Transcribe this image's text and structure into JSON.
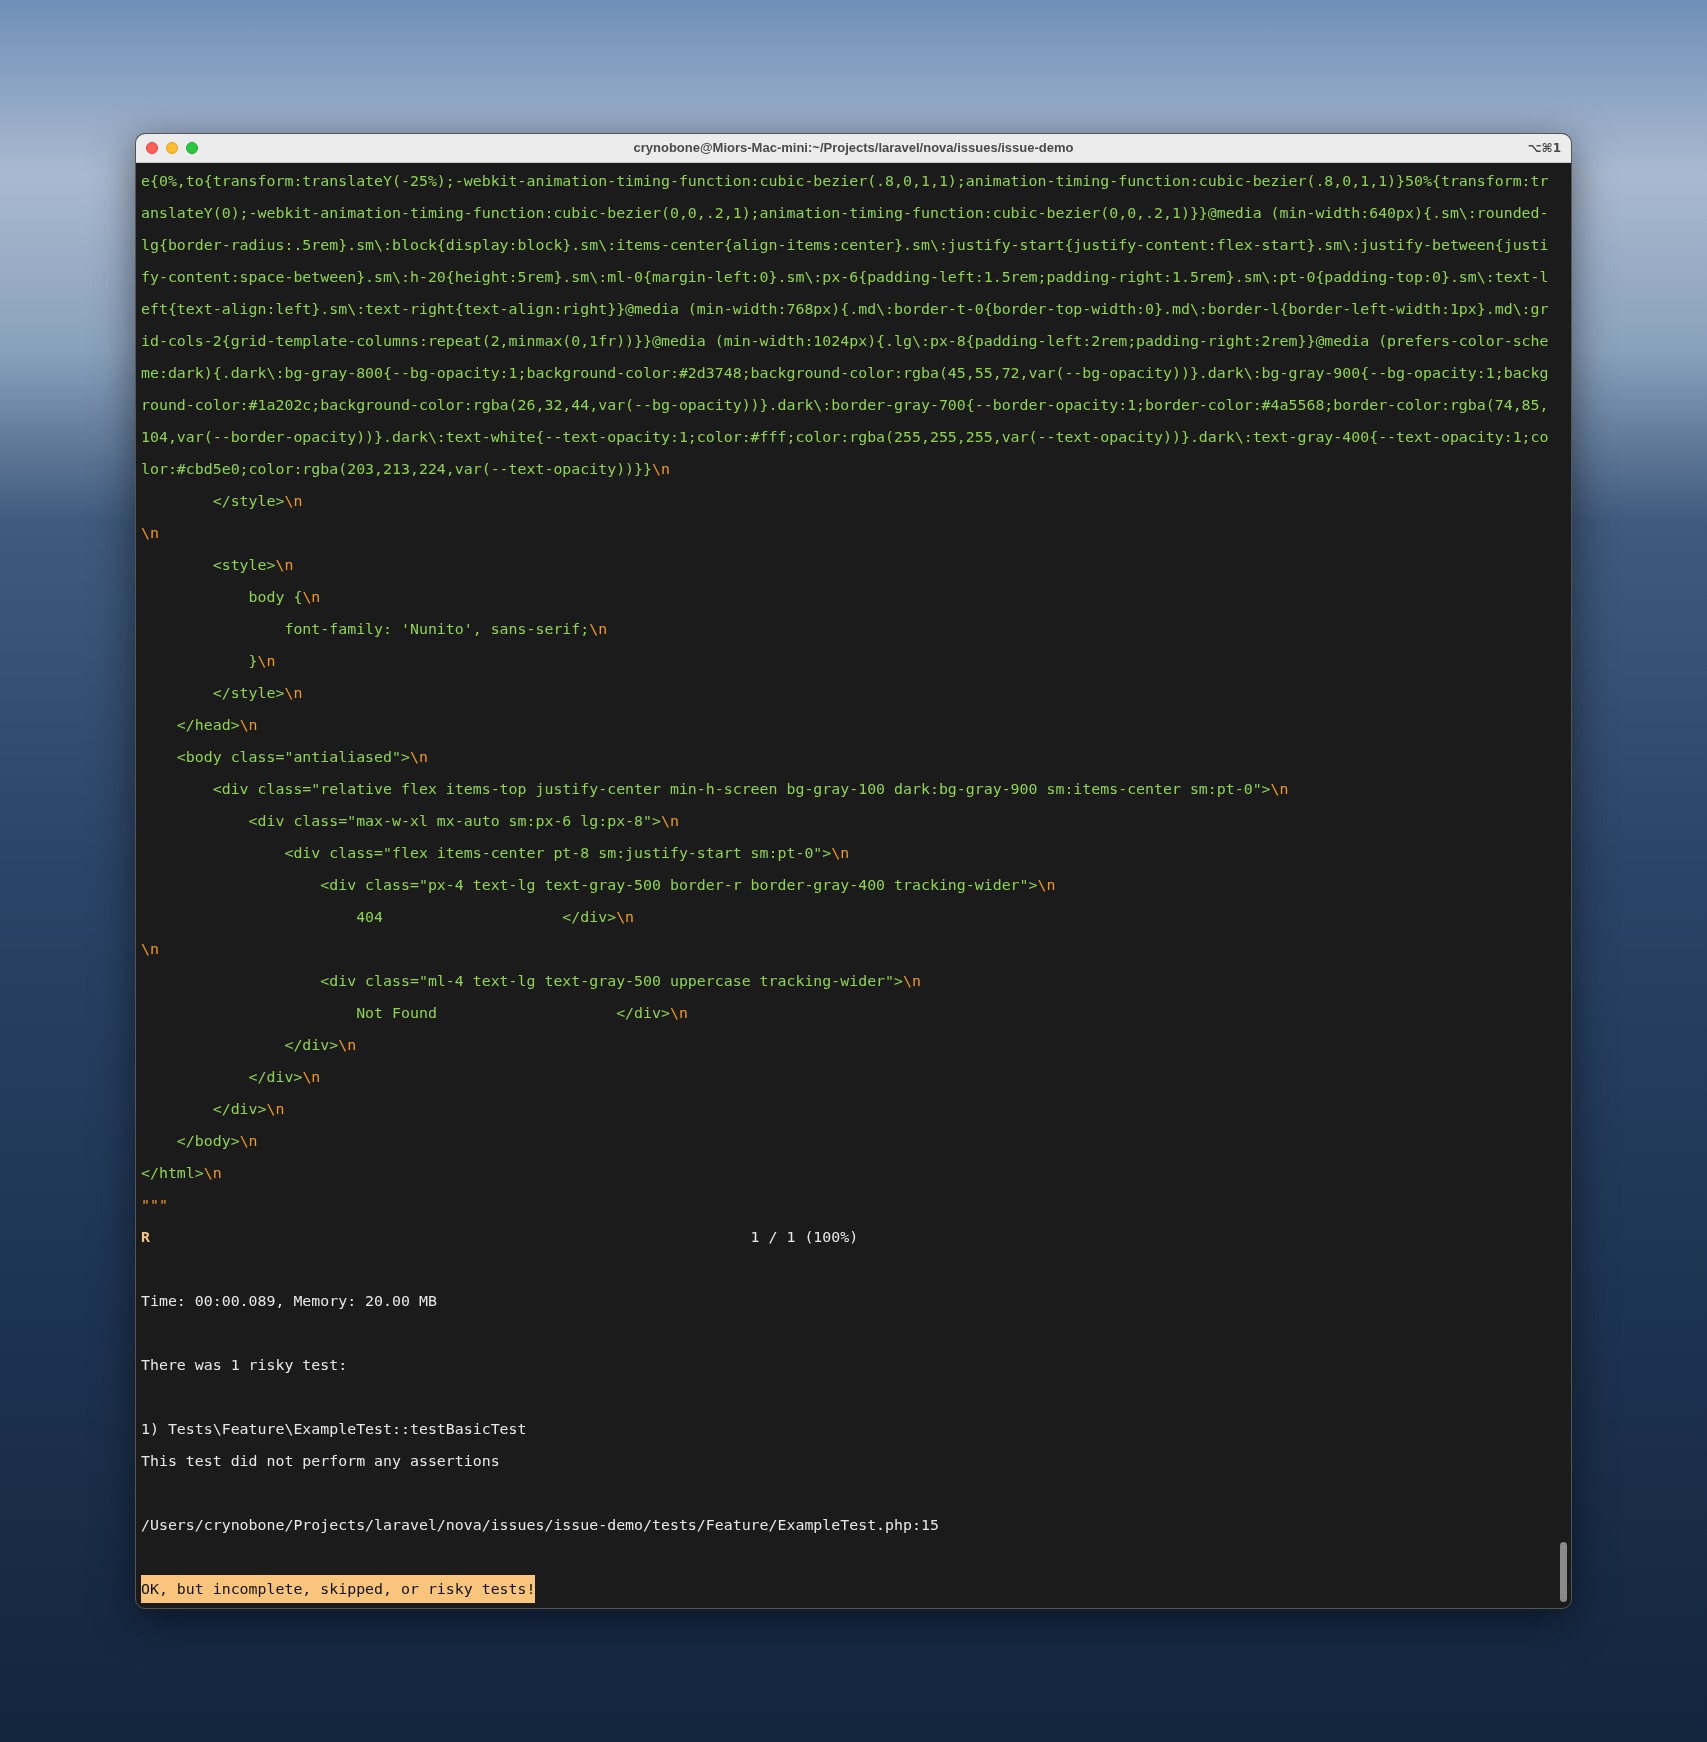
{
  "window": {
    "title": "crynobone@Miors-Mac-mini:~/Projects/laravel/nova/issues/issue-demo",
    "shortcut": "⌥⌘1"
  },
  "terminal": {
    "lines": [
      {
        "kind": "code",
        "text": "e{0%,to{transform:translateY(-25%);-webkit-animation-timing-function:cubic-bezier(.8,0,1,1);animation-timing-function:cubic-bezier(.8,0,1,1)}50%{transform:tr"
      },
      {
        "kind": "code",
        "text": "anslateY(0);-webkit-animation-timing-function:cubic-bezier(0,0,.2,1);animation-timing-function:cubic-bezier(0,0,.2,1)}}@media (min-width:640px){.sm\\:rounded-"
      },
      {
        "kind": "code",
        "text": "lg{border-radius:.5rem}.sm\\:block{display:block}.sm\\:items-center{align-items:center}.sm\\:justify-start{justify-content:flex-start}.sm\\:justify-between{justi"
      },
      {
        "kind": "code",
        "text": "fy-content:space-between}.sm\\:h-20{height:5rem}.sm\\:ml-0{margin-left:0}.sm\\:px-6{padding-left:1.5rem;padding-right:1.5rem}.sm\\:pt-0{padding-top:0}.sm\\:text-l"
      },
      {
        "kind": "code",
        "text": "eft{text-align:left}.sm\\:text-right{text-align:right}}@media (min-width:768px){.md\\:border-t-0{border-top-width:0}.md\\:border-l{border-left-width:1px}.md\\:gr"
      },
      {
        "kind": "code",
        "text": "id-cols-2{grid-template-columns:repeat(2,minmax(0,1fr))}}@media (min-width:1024px){.lg\\:px-8{padding-left:2rem;padding-right:2rem}}@media (prefers-color-sche"
      },
      {
        "kind": "code",
        "text": "me:dark){.dark\\:bg-gray-800{--bg-opacity:1;background-color:#2d3748;background-color:rgba(45,55,72,var(--bg-opacity))}.dark\\:bg-gray-900{--bg-opacity:1;backg"
      },
      {
        "kind": "code",
        "text": "round-color:#1a202c;background-color:rgba(26,32,44,var(--bg-opacity))}.dark\\:border-gray-700{--border-opacity:1;border-color:#4a5568;border-color:rgba(74,85,"
      },
      {
        "kind": "code",
        "text": "104,var(--border-opacity))}.dark\\:text-white{--text-opacity:1;color:#fff;color:rgba(255,255,255,var(--text-opacity))}.dark\\:text-gray-400{--text-opacity:1;co"
      },
      {
        "kind": "code",
        "text": "lor:#cbd5e0;color:rgba(203,213,224,var(--text-opacity))}}",
        "newline": "\\n"
      },
      {
        "kind": "code",
        "text": "        </style>",
        "newline": "\\n"
      },
      {
        "kind": "marker",
        "text": "\\n"
      },
      {
        "kind": "code",
        "text": "        <style>",
        "newline": "\\n"
      },
      {
        "kind": "code",
        "text": "            body {",
        "newline": "\\n"
      },
      {
        "kind": "code",
        "text": "                font-family: 'Nunito', sans-serif;",
        "newline": "\\n"
      },
      {
        "kind": "code",
        "text": "            }",
        "newline": "\\n"
      },
      {
        "kind": "code",
        "text": "        </style>",
        "newline": "\\n"
      },
      {
        "kind": "code",
        "text": "    </head>",
        "newline": "\\n"
      },
      {
        "kind": "code",
        "text": "    <body class=\"antialiased\">",
        "newline": "\\n"
      },
      {
        "kind": "code",
        "text": "        <div class=\"relative flex items-top justify-center min-h-screen bg-gray-100 dark:bg-gray-900 sm:items-center sm:pt-0\">",
        "newline": "\\n"
      },
      {
        "kind": "code",
        "text": "            <div class=\"max-w-xl mx-auto sm:px-6 lg:px-8\">",
        "newline": "\\n"
      },
      {
        "kind": "code",
        "text": "                <div class=\"flex items-center pt-8 sm:justify-start sm:pt-0\">",
        "newline": "\\n"
      },
      {
        "kind": "code",
        "text": "                    <div class=\"px-4 text-lg text-gray-500 border-r border-gray-400 tracking-wider\">",
        "newline": "\\n"
      },
      {
        "kind": "code",
        "text": "                        404                    </div>",
        "newline": "\\n"
      },
      {
        "kind": "marker",
        "text": "\\n"
      },
      {
        "kind": "code",
        "text": "                    <div class=\"ml-4 text-lg text-gray-500 uppercase tracking-wider\">",
        "newline": "\\n"
      },
      {
        "kind": "code",
        "text": "                        Not Found                    </div>",
        "newline": "\\n"
      },
      {
        "kind": "code",
        "text": "                </div>",
        "newline": "\\n"
      },
      {
        "kind": "code",
        "text": "            </div>",
        "newline": "\\n"
      },
      {
        "kind": "code",
        "text": "        </div>",
        "newline": "\\n"
      },
      {
        "kind": "code",
        "text": "    </body>",
        "newline": "\\n"
      },
      {
        "kind": "code",
        "text": "</html>",
        "newline": "\\n"
      },
      {
        "kind": "marker",
        "text": "\"\"\""
      },
      {
        "kind": "progress",
        "text": "R",
        "progress": "1 / 1 (100%)"
      },
      {
        "kind": "blank"
      },
      {
        "kind": "output",
        "text": "Time: 00:00.089, Memory: 20.00 MB"
      },
      {
        "kind": "blank"
      },
      {
        "kind": "output",
        "text": "There was 1 risky test:"
      },
      {
        "kind": "blank"
      },
      {
        "kind": "output",
        "text": "1) Tests\\Feature\\ExampleTest::testBasicTest"
      },
      {
        "kind": "output",
        "text": "This test did not perform any assertions"
      },
      {
        "kind": "blank"
      },
      {
        "kind": "output",
        "text": "/Users/crynobone/Projects/laravel/nova/issues/issue-demo/tests/Feature/ExampleTest.php:15"
      },
      {
        "kind": "blank"
      },
      {
        "kind": "banner",
        "text": "OK, but incomplete, skipped, or risky tests!"
      }
    ]
  }
}
